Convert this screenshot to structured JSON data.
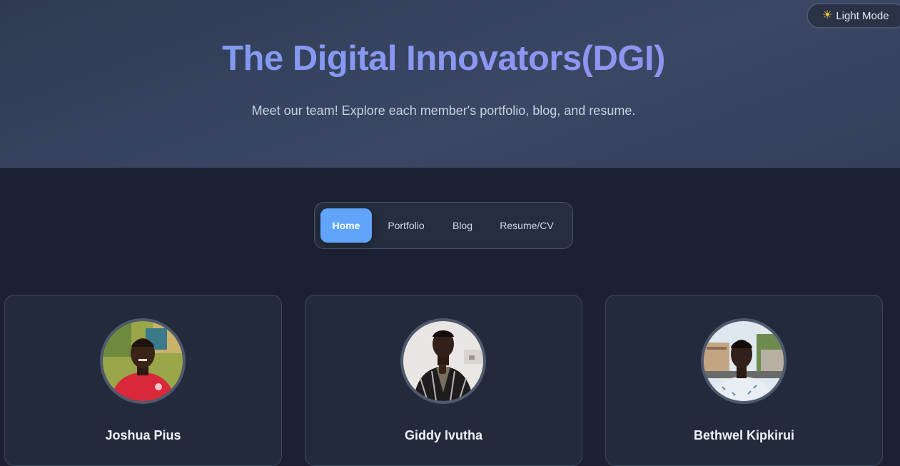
{
  "theme_toggle": {
    "label": "Light Mode",
    "icon": "sun-icon"
  },
  "hero": {
    "title": "The Digital Innovators(DGI)",
    "subtitle": "Meet our team! Explore each member's portfolio, blog, and resume."
  },
  "nav": {
    "items": [
      {
        "label": "Home",
        "active": true
      },
      {
        "label": "Portfolio",
        "active": false
      },
      {
        "label": "Blog",
        "active": false
      },
      {
        "label": "Resume/CV",
        "active": false
      }
    ]
  },
  "members": [
    {
      "name": "Joshua Pius"
    },
    {
      "name": "Giddy Ivutha"
    },
    {
      "name": "Bethwel Kipkirui"
    }
  ],
  "colors": {
    "accent": "#60a5fa",
    "background": "#1b2132",
    "card": "#232a3b",
    "title_gradient_start": "#7c9cf0",
    "title_gradient_end": "#9a8df0"
  }
}
